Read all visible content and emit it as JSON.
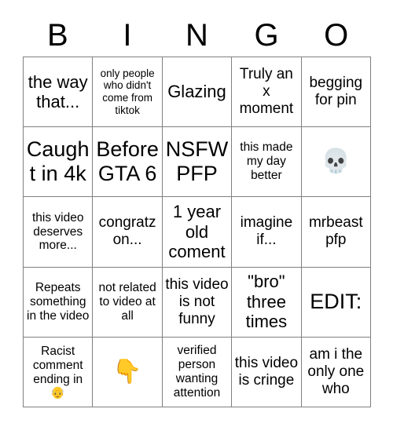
{
  "card": {
    "header_letters": [
      "B",
      "I",
      "N",
      "G",
      "O"
    ],
    "rows": [
      [
        {
          "text": "the way that...",
          "size": "lg"
        },
        {
          "text": "only people who didn't come from tiktok",
          "size": "xs"
        },
        {
          "text": "Glazing",
          "size": "lg"
        },
        {
          "text": "Truly an x moment",
          "size": "md"
        },
        {
          "text": "begging for pin",
          "size": "md"
        }
      ],
      [
        {
          "text": "Caught in 4k",
          "size": "xl"
        },
        {
          "text": "Before GTA 6",
          "size": "xl"
        },
        {
          "text": "NSFW PFP",
          "size": "xl"
        },
        {
          "text": "this made my day better",
          "size": "sm"
        },
        {
          "text": "",
          "emoji": "💀",
          "icon_name": "skull-emoji",
          "size": "md"
        }
      ],
      [
        {
          "text": "this video deserves more...",
          "size": "sm"
        },
        {
          "text": "congratz on...",
          "size": "md"
        },
        {
          "text": "1 year old coment",
          "size": "lg"
        },
        {
          "text": "imagine if...",
          "size": "md"
        },
        {
          "text": "mrbeast pfp",
          "size": "md"
        }
      ],
      [
        {
          "text": "Repeats something in the video",
          "size": "sm"
        },
        {
          "text": "not related to video at all",
          "size": "sm"
        },
        {
          "text": "this video is not funny",
          "size": "md"
        },
        {
          "text": "\"bro\" three times",
          "size": "lg"
        },
        {
          "text": "EDIT:",
          "size": "xl"
        }
      ],
      [
        {
          "text": "Racist comment ending in ",
          "emoji_suffix": "👴",
          "icon_name": "old-man-emoji",
          "size": "sm"
        },
        {
          "text": "",
          "emoji": "👇",
          "icon_name": "backhand-index-pointing-down-emoji",
          "size": "md"
        },
        {
          "text": "verified person wanting attention",
          "size": "sm"
        },
        {
          "text": "this video is cringe",
          "size": "md"
        },
        {
          "text": "am i the only one who",
          "size": "md"
        }
      ]
    ],
    "colors": {
      "background": "#ffffff",
      "text": "#000000",
      "grid_line": "#808080"
    }
  }
}
